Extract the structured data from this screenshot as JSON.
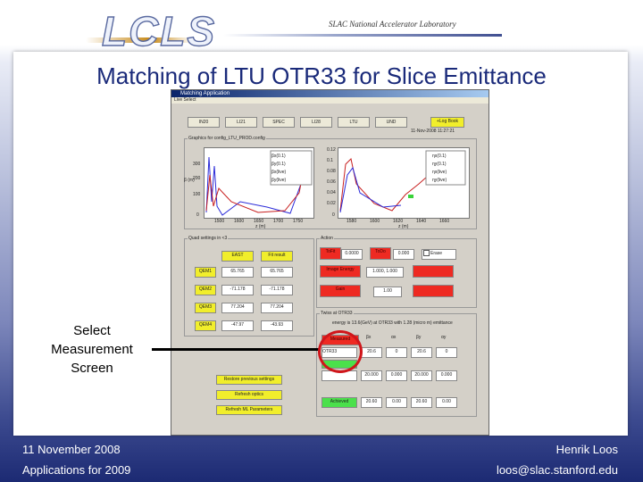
{
  "header": {
    "logo_text": "LCLS",
    "lab_name": "SLAC National Accelerator Laboratory"
  },
  "title": "Matching of LTU OTR33 for Slice Emittance",
  "app": {
    "window_title": "Matching Application",
    "menu": "Live Select",
    "section_buttons": [
      "IN20",
      "LI21",
      "SPEC",
      "LI28",
      "LTU",
      "UND"
    ],
    "log_book": "+Log Book",
    "timestamp": "11-Nov-2008 11:27:21",
    "plot_title": "Graphics for config_LTU_PROD.config",
    "plot1_yticks": [
      "300",
      "200",
      "100",
      "0"
    ],
    "plot1_xticks": [
      "1500",
      "1600",
      "1650",
      "1700",
      "1750"
    ],
    "plot1_xlabel": "z (m)",
    "plot1_ylabel": "β (m)",
    "plot1_legend": [
      "βx(0.1)",
      "βy(0.1)",
      "βx(live)",
      "βy(live)"
    ],
    "plot2_yticks": [
      "0.12",
      "0.1",
      "0.08",
      "0.06",
      "0.04",
      "0.02",
      "0"
    ],
    "plot2_xticks": [
      "1580",
      "1600",
      "1620",
      "1640",
      "1660"
    ],
    "plot2_xlabel": "z (m)",
    "plot2_legend": [
      "ηx(0.1)",
      "ηy(0.1)",
      "ηx(live)",
      "ηy(live)"
    ],
    "quad_panel_title": "Quad settings in <3",
    "col_east": "EAST",
    "col_fit": "Fit result",
    "quads": [
      {
        "name": "QEM1",
        "east": "65.765",
        "fit": "65.765"
      },
      {
        "name": "QEM2",
        "east": "-71.178",
        "fit": "-71.178"
      },
      {
        "name": "QEM3",
        "east": "77.204",
        "fit": "77.204"
      },
      {
        "name": "QEM4",
        "east": "-47.97",
        "fit": "-43.93"
      }
    ],
    "action_title": "Action",
    "tofit_label": "ToFit",
    "tofit_val": "0.0000",
    "todo_label": "ToDo",
    "todo_val": "0.000",
    "erase_label": "Erase",
    "energy_label": "Image Energy",
    "energy_val": "1.000, 1.000",
    "gain_label": "Gain",
    "gain_val": "1.00",
    "twiss_title": "Twiss at OTR33",
    "twiss_info": "energy is 13.6(GeV) at OTR33 with 1.28 (micro m) emittance",
    "measured_label": "Measured",
    "profile_select": "OTR33",
    "twiss_headers": [
      "βx",
      "αx",
      "βy",
      "αy"
    ],
    "twiss_row1": [
      "20.6",
      "0",
      "20.6",
      "0"
    ],
    "twiss_row2": [
      "20.000",
      "0.000",
      "20.000",
      "0.000"
    ],
    "achieved_label": "Achieved",
    "twiss_row3": [
      "20.60",
      "0.00",
      "20.60",
      "0.00"
    ],
    "restore_btn": "Restore previous settings",
    "refresh_optics_btn": "Refresh optics",
    "refresh_ml_btn": "Refresh ML Parameters"
  },
  "callout": {
    "line1": "Select",
    "line2": "Measurement",
    "line3": "Screen"
  },
  "footer": {
    "date": "11 November 2008",
    "author": "Henrik Loos",
    "subtitle": "Applications for 2009",
    "email": "loos@slac.stanford.edu"
  },
  "colors": {
    "title": "#1a2a7a",
    "highlight_circle": "#d0161b",
    "yellow_button": "#f1ee2b",
    "red_button": "#ee2a22",
    "green_field": "#4be04b"
  }
}
